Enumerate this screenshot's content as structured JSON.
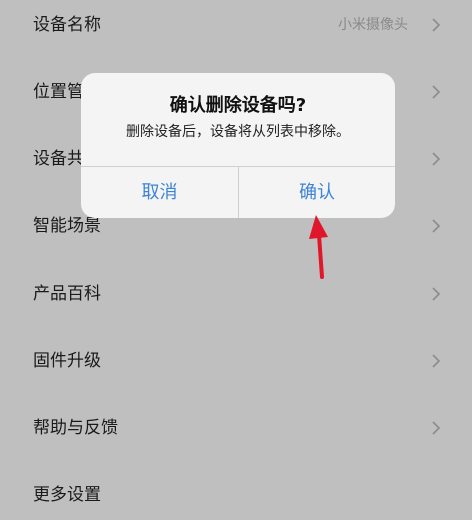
{
  "settings": {
    "items": [
      {
        "label": "设备名称",
        "value": "小米摄像头"
      },
      {
        "label": "位置管理",
        "value": ""
      },
      {
        "label": "设备共享",
        "value": ""
      },
      {
        "label": "智能场景",
        "value": ""
      },
      {
        "label": "产品百科",
        "value": ""
      },
      {
        "label": "固件升级",
        "value": ""
      },
      {
        "label": "帮助与反馈",
        "value": ""
      },
      {
        "label": "更多设置",
        "value": ""
      }
    ]
  },
  "dialog": {
    "title": "确认删除设备吗?",
    "message": "删除设备后，设备将从列表中移除。",
    "cancel_label": "取消",
    "confirm_label": "确认"
  },
  "icons": {
    "row_chevron": "chevron-right-icon",
    "annotation": "red-arrow-icon"
  },
  "colors": {
    "page_background": "#bfbfbf",
    "dialog_background": "#f4f4f4",
    "button_text": "#3d84d6",
    "annotation_arrow": "#e0162b"
  }
}
